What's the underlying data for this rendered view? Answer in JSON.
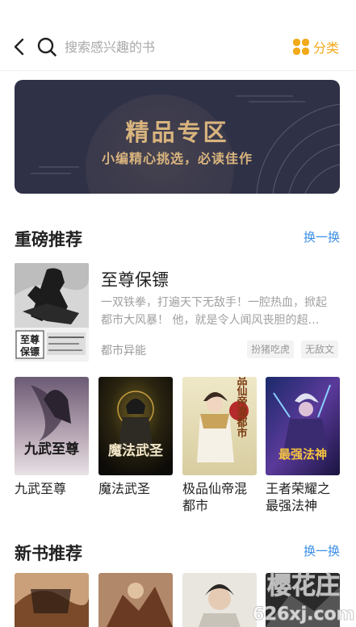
{
  "header": {
    "back_icon": "chevron-left-icon",
    "search_icon": "search-icon",
    "search_placeholder": "搜索感兴趣的书",
    "category_icon": "category-grid-icon",
    "category_label": "分类",
    "accent": "#f2a91a"
  },
  "banner": {
    "title": "精品专区",
    "subtitle": "小编精心挑选，必读佳作",
    "bg_color": "#2f3146",
    "text_color": "#d9b47e"
  },
  "hot_section": {
    "title": "重磅推荐",
    "more_label": "换一换",
    "featured": {
      "title": "至尊保镖",
      "desc_line1": "一双铁拳，打遍天下无敌手！一腔热血，掀起",
      "desc_line2": "都市大风暴！  他，就是令人闻风丧胆的超…",
      "category": "都市异能",
      "tags": [
        "扮猪吃虎",
        "无敌文"
      ],
      "cover_text_1": "至尊",
      "cover_text_2": "保镖"
    },
    "books": [
      {
        "title": "九武至尊",
        "cover_text": "九武至尊"
      },
      {
        "title": "魔法武圣",
        "cover_text": "魔法武圣"
      },
      {
        "title": "极品仙帝混都市",
        "cover_text": "极品仙帝混都市"
      },
      {
        "title": "王者荣耀之最强法神",
        "cover_text": "最强法神"
      }
    ]
  },
  "new_section": {
    "title": "新书推荐",
    "more_label": "换一换"
  },
  "link_color": "#3a8ee6",
  "watermark": {
    "line1": "樱花庄",
    "line2": "626xj.com"
  }
}
